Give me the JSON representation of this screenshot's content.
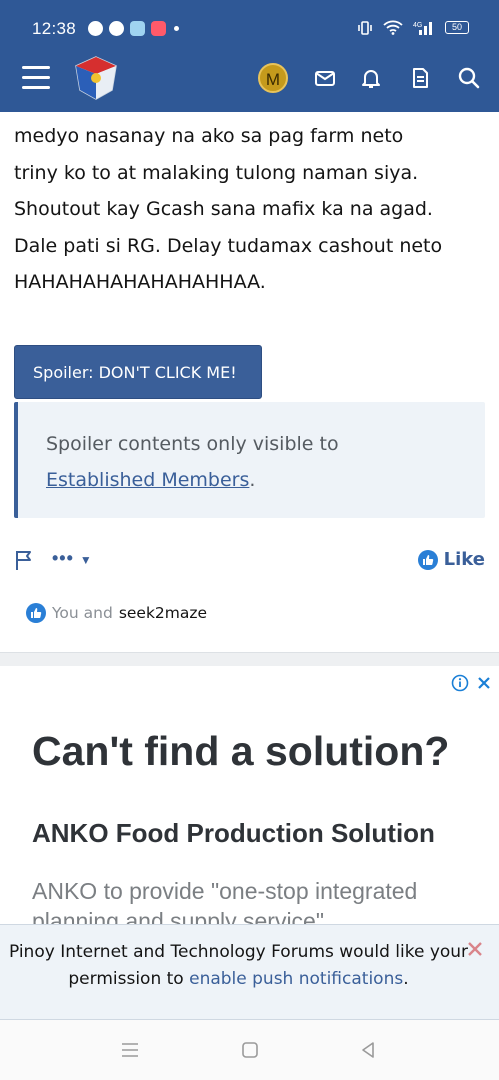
{
  "status_bar": {
    "time": "12:38",
    "battery": "50",
    "signal_label": "4G"
  },
  "nav": {
    "avatar_letter": "M",
    "icons": [
      "menu-icon",
      "site-logo",
      "avatar",
      "mail-icon",
      "bell-icon",
      "document-icon",
      "search-icon"
    ]
  },
  "post": {
    "lines": [
      "medyo nasanay na ako sa pag farm neto",
      "triny ko to at malaking tulong naman siya.",
      "Shoutout kay Gcash sana mafix ka na agad.",
      "Dale pati si RG. Delay tudamax cashout neto",
      "HAHAHAHAHAHAHAHHAA."
    ],
    "spoiler_button": "Spoiler: DON'T CLICK ME!",
    "spoiler_text": "Spoiler contents only visible to",
    "spoiler_link": "Established Members",
    "spoiler_period": "."
  },
  "actions": {
    "more": "•••",
    "like_label": "Like"
  },
  "reactions": {
    "prefix": "You and",
    "users": "seek2maze"
  },
  "ad": {
    "headline": "Can't find a solution?",
    "subheadline": "ANKO Food Production Solution",
    "body": "ANKO to provide \"one-stop integrated planning and supply service\""
  },
  "push": {
    "text_before": "Pinoy Internet and Technology Forums would like your permission to ",
    "link": "enable push notifications",
    "text_after": "."
  },
  "colors": {
    "primary": "#2f5896",
    "button": "#3a5f99",
    "like_blue": "#2a7fd6",
    "spoiler_bg": "#eef3f8"
  }
}
